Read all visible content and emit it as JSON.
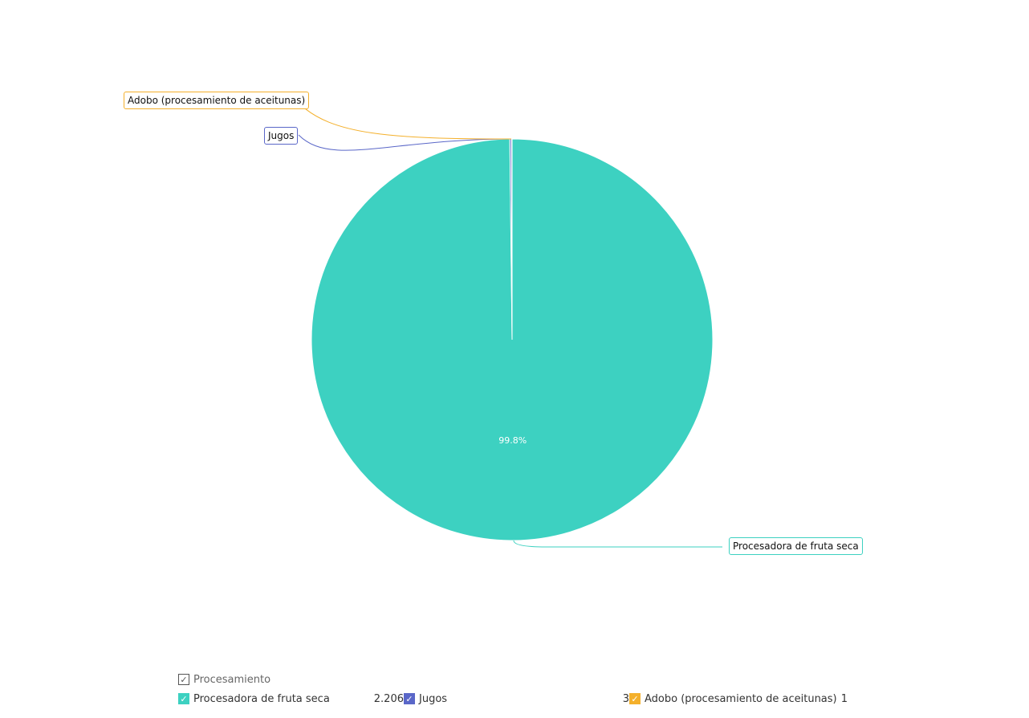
{
  "chart_data": {
    "type": "pie",
    "title": "",
    "categories": [
      "Procesadora de fruta seca",
      "Jugos",
      "Adobo (procesamiento de aceitunas)"
    ],
    "values": [
      2206,
      3,
      1
    ],
    "value_labels": [
      "2.206",
      "3",
      "1"
    ],
    "colors": [
      "#3dd1c1",
      "#5a67c8",
      "#f4b02c"
    ],
    "slice_percent_labels": [
      "99.8%",
      "",
      ""
    ],
    "legend": {
      "title": "Procesamiento",
      "placement": "bottom"
    }
  }
}
